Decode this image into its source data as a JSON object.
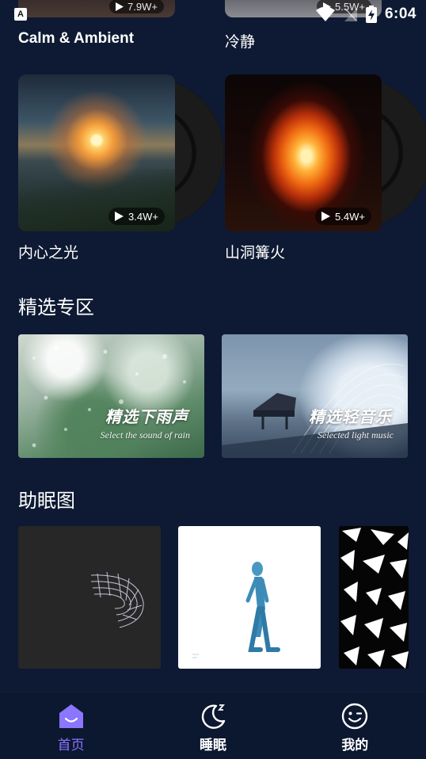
{
  "status_bar": {
    "time": "6:04",
    "app_badge": "A"
  },
  "top_row": [
    {
      "title": "Calm & Ambient",
      "plays": "7.9W+"
    },
    {
      "title": "冷静",
      "plays": "5.5W+"
    }
  ],
  "albums": [
    {
      "title": "内心之光",
      "plays": "3.4W+"
    },
    {
      "title": "山洞篝火",
      "plays": "5.4W+"
    }
  ],
  "featured": {
    "title": "精选专区",
    "banners": [
      {
        "label": "精选下雨声",
        "sub": "Select the sound of rain"
      },
      {
        "label": "精选轻音乐",
        "sub": "Selected light music"
      }
    ]
  },
  "sleep_images": {
    "title": "助眠图"
  },
  "nav": {
    "home": "首页",
    "sleep": "睡眠",
    "mine": "我的",
    "active_color": "#8a76ff"
  }
}
